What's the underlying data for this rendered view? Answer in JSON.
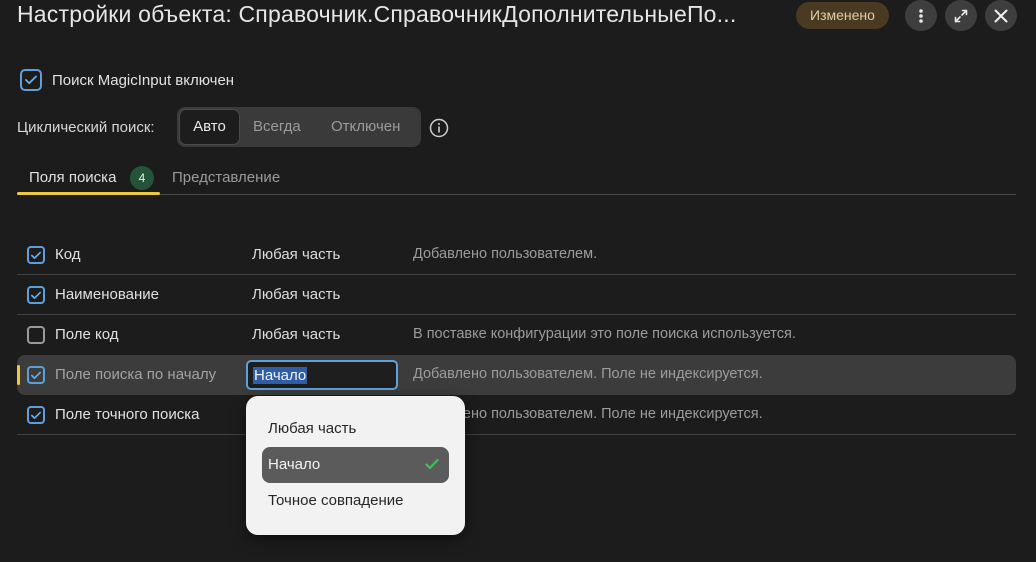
{
  "header": {
    "title": "Настройки объекта: Справочник.СправочникДополнительныеПо...",
    "badge": "Изменено"
  },
  "magic_input": {
    "label": "Поиск MagicInput включен",
    "checked": true
  },
  "cyclic_search": {
    "label": "Циклический поиск:",
    "options": [
      "Авто",
      "Всегда",
      "Отключен"
    ],
    "selected": "Авто"
  },
  "tabs": [
    {
      "label": "Поля поиска",
      "count": "4",
      "active": true
    },
    {
      "label": "Представление",
      "active": false
    }
  ],
  "fields": [
    {
      "name": "Код",
      "mode": "Любая часть",
      "note": "Добавлено пользователем.",
      "checked": true
    },
    {
      "name": "Наименование",
      "mode": "Любая часть",
      "note": "",
      "checked": true
    },
    {
      "name": "Поле код",
      "mode": "Любая часть",
      "note": "В поставке конфигурации это поле поиска используется.",
      "checked": false
    },
    {
      "name": "Поле поиска по началу",
      "mode": "Начало",
      "note": "Добавлено пользователем. Поле не индексируется.",
      "checked": true,
      "selected": true
    },
    {
      "name": "Поле точного поиска",
      "mode": "",
      "note": "Добавлено пользователем. Поле не индексируется.",
      "checked": true
    }
  ],
  "dropdown": {
    "options": [
      "Любая часть",
      "Начало",
      "Точное совпадение"
    ],
    "selected": "Начало"
  },
  "colors": {
    "accent": "#5e9fd8",
    "tab_underline": "#f0c93a",
    "check_green": "#3fbf5a",
    "badge_bg": "#4a3a22"
  }
}
